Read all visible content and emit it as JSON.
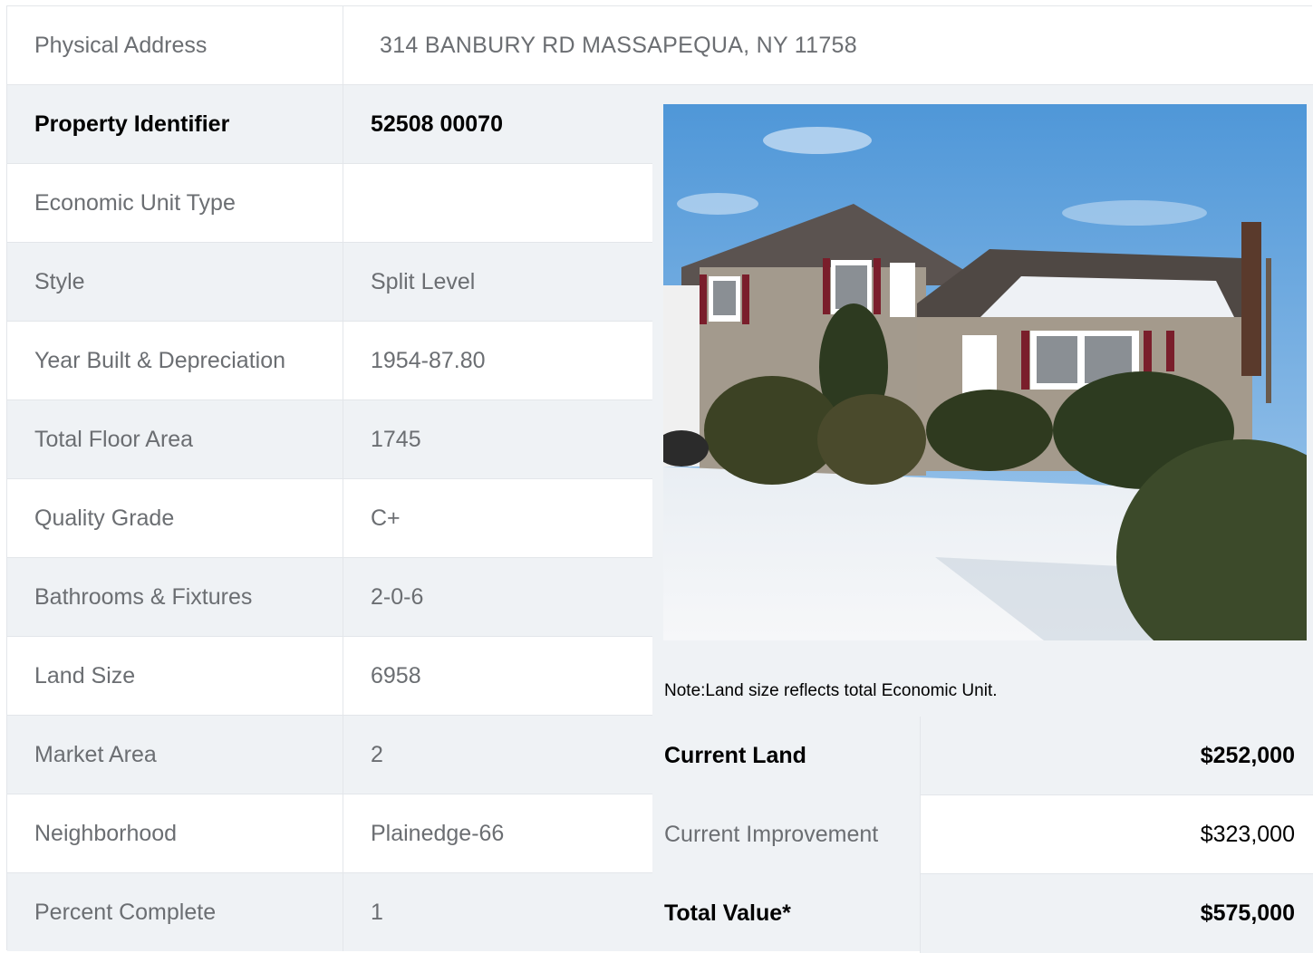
{
  "address": {
    "label": "Physical Address",
    "value": "314  BANBURY RD  MASSAPEQUA, NY  11758"
  },
  "property_rows": [
    {
      "label": "Property Identifier",
      "value": "52508  00070"
    },
    {
      "label": "Economic Unit Type",
      "value": ""
    },
    {
      "label": "Style",
      "value": "Split Level"
    },
    {
      "label": "Year Built & Depreciation",
      "value": "1954-87.80"
    },
    {
      "label": "Total Floor Area",
      "value": "1745"
    },
    {
      "label": "Quality Grade",
      "value": "C+"
    },
    {
      "label": "Bathrooms & Fixtures",
      "value": "2-0-6"
    },
    {
      "label": "Land Size",
      "value": "6958"
    },
    {
      "label": "Market Area",
      "value": "2"
    },
    {
      "label": "Neighborhood",
      "value": "Plainedge-66"
    },
    {
      "label": "Percent Complete",
      "value": "1"
    }
  ],
  "note": "Note:Land size reflects total Economic Unit.",
  "valuation": [
    {
      "label": "Current Land",
      "value": "$252,000"
    },
    {
      "label": "Current Improvement",
      "value": "$323,000"
    },
    {
      "label": "Total Value*",
      "value": "$575,000"
    }
  ],
  "photo": {
    "icon": "house-photo"
  }
}
